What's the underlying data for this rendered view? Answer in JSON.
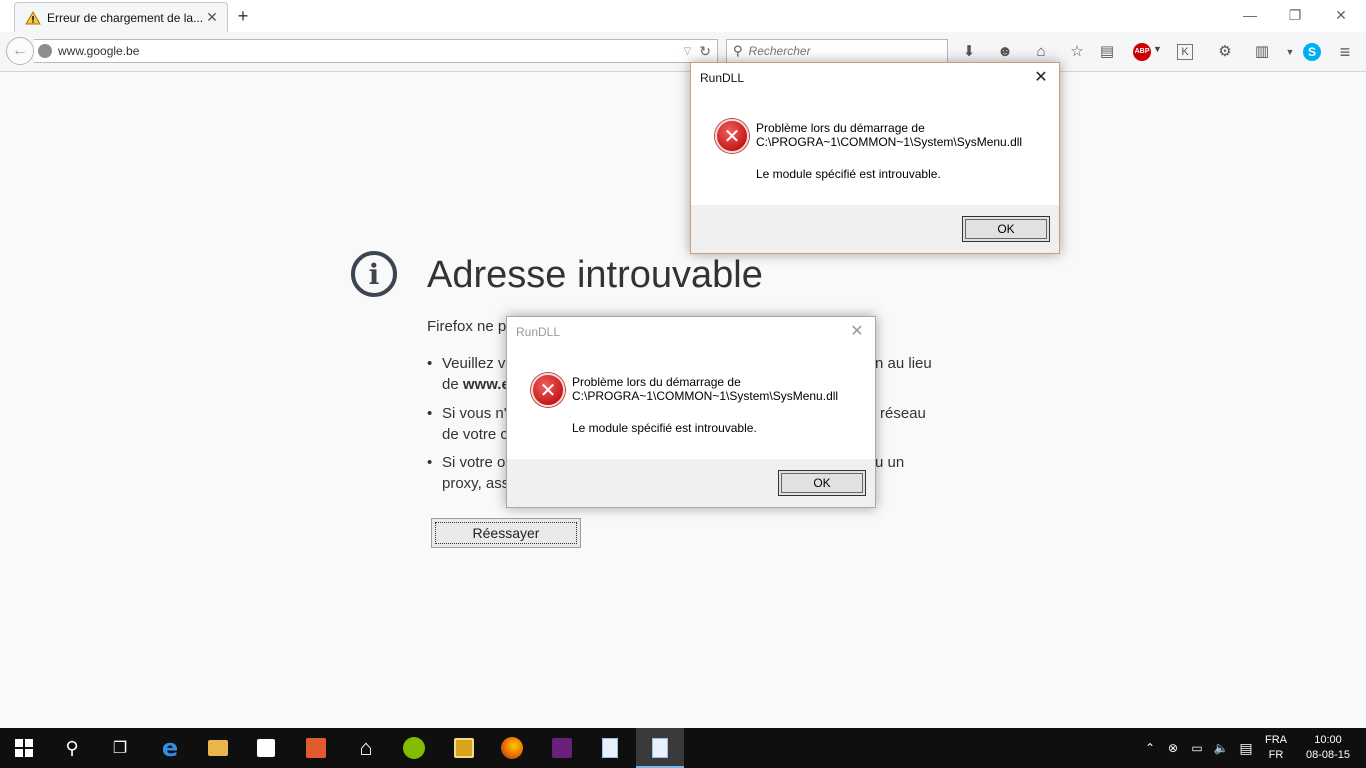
{
  "browser": {
    "tab_title": "Erreur de chargement de la...",
    "url": "www.google.be",
    "search_placeholder": "Rechercher"
  },
  "error_page": {
    "title": "Adresse introuvable",
    "intro": "Firefox ne pe",
    "bullets": [
      {
        "line1_a": "Veuillez ve",
        "line1_b": "n au lieu",
        "line2_a": "de ",
        "line2_bold": "www.e"
      },
      {
        "line1_a": "Si vous n'a",
        "line1_b": "réseau",
        "line2_a": "de votre c"
      },
      {
        "line1_a": "Si votre o",
        "line1_b": "u un",
        "line2_a": "proxy, ass"
      }
    ],
    "retry_label": "Réessayer"
  },
  "dialogs": [
    {
      "title": "RunDLL",
      "message_line1": "Problème lors du démarrage de",
      "message_line2": "C:\\PROGRA~1\\COMMON~1\\System\\SysMenu.dll",
      "detail": "Le module spécifié est introuvable.",
      "ok_label": "OK"
    },
    {
      "title": "RunDLL",
      "message_line1": "Problème lors du démarrage de",
      "message_line2": "C:\\PROGRA~1\\COMMON~1\\System\\SysMenu.dll",
      "detail": "Le module spécifié est introuvable.",
      "ok_label": "OK"
    }
  ],
  "taskbar": {
    "language_top": "FRA",
    "language_bottom": "FR",
    "time": "10:00",
    "date": "08-08-15"
  },
  "toolbar": {
    "abp_label": "ABP",
    "k_label": "K"
  },
  "colors": {
    "accent": "#76b9ed",
    "error_red": "#c61a1a",
    "skype": "#00aff0"
  }
}
